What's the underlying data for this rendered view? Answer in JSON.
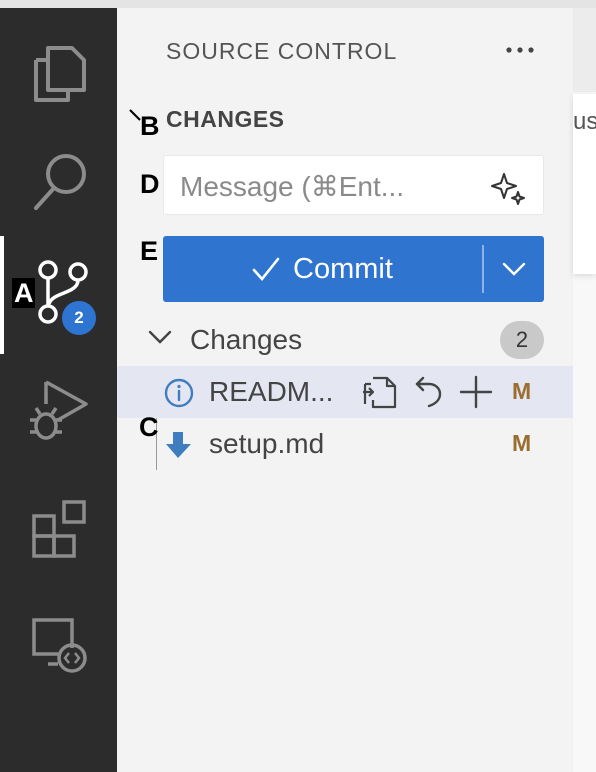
{
  "sidebar": {
    "title": "SOURCE CONTROL",
    "section_header": "CHANGES",
    "message_placeholder": "Message (⌘Ent...",
    "commit_label": "Commit",
    "group_label": "Changes",
    "group_count": "2",
    "files": [
      {
        "name": "READM...",
        "status": "M",
        "icon": "info-icon"
      },
      {
        "name": "setup.md",
        "status": "M",
        "icon": "arrow-down-icon"
      }
    ]
  },
  "activity_bar": {
    "items": [
      "explorer-icon",
      "search-icon",
      "source-control-icon",
      "run-debug-icon",
      "extensions-icon",
      "remote-explorer-icon"
    ],
    "source_control_badge": "2"
  },
  "editor_peek_text": "us",
  "annotations": {
    "a": "A",
    "b": "B",
    "c": "C",
    "d": "D",
    "e": "E"
  },
  "colors": {
    "accent": "#2f74cf",
    "activity_bar": "#2c2c2c",
    "modified": "#9a6e2f"
  }
}
